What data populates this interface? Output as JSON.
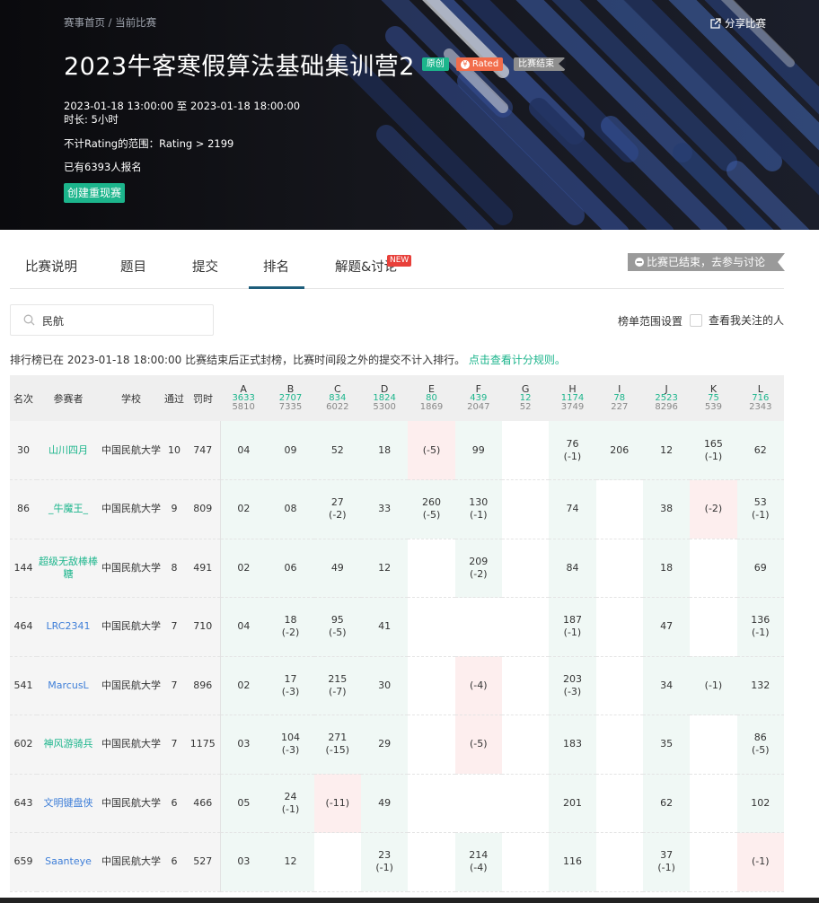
{
  "banner": {
    "breadcrumb": "赛事首页 / 当前比赛",
    "share_label": "分享比赛",
    "title": "2023牛客寒假算法基础集训营2",
    "tags": {
      "original": "原创",
      "rated": "Rated",
      "status": "比赛结束"
    },
    "time_range": "2023-01-18 13:00:00 至 2023-01-18 18:00:00",
    "duration": "时长: 5小时",
    "rating_range": "不计Rating的范围：Rating > 2199",
    "registered": "已有6393人报名",
    "replay_button": "创建重现赛"
  },
  "tabs": [
    {
      "label": "比赛说明"
    },
    {
      "label": "题目"
    },
    {
      "label": "提交"
    },
    {
      "label": "排名"
    },
    {
      "label": "解题&讨论"
    }
  ],
  "active_tab": "排名",
  "new_badge": "NEW",
  "discuss_button": "比赛已结束，去参与讨论",
  "search": {
    "value": "民航"
  },
  "range_setting": "榜单范围设置",
  "follow_label": "查看我关注的人",
  "notice": {
    "text": "排行榜已在 2023-01-18 18:00:00 比赛结束后正式封榜，比赛时间段之外的提交不计入排行。",
    "link": "点击查看计分规则。"
  },
  "colors": {
    "accent": "#1cb58c",
    "accepted_bg": "#f0f8f5",
    "failed_bg": "#fdeeee",
    "link_blue": "#3f7fd8"
  },
  "table": {
    "headers": {
      "rank": "名次",
      "team": "参赛者",
      "school": "学校",
      "solved": "通过",
      "penalty": "罚时"
    },
    "problems": [
      {
        "id": "A",
        "ac": "3633",
        "tried": "5810"
      },
      {
        "id": "B",
        "ac": "2707",
        "tried": "7335"
      },
      {
        "id": "C",
        "ac": "834",
        "tried": "6022"
      },
      {
        "id": "D",
        "ac": "1824",
        "tried": "5300"
      },
      {
        "id": "E",
        "ac": "80",
        "tried": "1869"
      },
      {
        "id": "F",
        "ac": "439",
        "tried": "2047"
      },
      {
        "id": "G",
        "ac": "12",
        "tried": "52"
      },
      {
        "id": "H",
        "ac": "1174",
        "tried": "3749"
      },
      {
        "id": "I",
        "ac": "78",
        "tried": "227"
      },
      {
        "id": "J",
        "ac": "2523",
        "tried": "8296"
      },
      {
        "id": "K",
        "ac": "75",
        "tried": "539"
      },
      {
        "id": "L",
        "ac": "716",
        "tried": "2343"
      }
    ],
    "rows": [
      {
        "rank": "30",
        "name": "山川四月",
        "name_color": "green",
        "school": "中国民航大学",
        "solved": "10",
        "penalty": "747",
        "cells": [
          {
            "s": "ok",
            "t": "04"
          },
          {
            "s": "ok",
            "t": "09"
          },
          {
            "s": "ok",
            "t": "52"
          },
          {
            "s": "ok",
            "t": "18"
          },
          {
            "s": "no",
            "t": "(-5)"
          },
          {
            "s": "ok",
            "t": "99"
          },
          {
            "s": "em",
            "t": ""
          },
          {
            "s": "ok",
            "t": "76",
            "w": "(-1)"
          },
          {
            "s": "ok",
            "t": "206"
          },
          {
            "s": "ok",
            "t": "12"
          },
          {
            "s": "ok",
            "t": "165",
            "w": "(-1)"
          },
          {
            "s": "ok",
            "t": "62"
          }
        ]
      },
      {
        "rank": "86",
        "name": "_牛魔王_",
        "name_color": "green",
        "school": "中国民航大学",
        "solved": "9",
        "penalty": "809",
        "cells": [
          {
            "s": "ok",
            "t": "02"
          },
          {
            "s": "ok",
            "t": "08"
          },
          {
            "s": "ok",
            "t": "27",
            "w": "(-2)"
          },
          {
            "s": "ok",
            "t": "33"
          },
          {
            "s": "ok",
            "t": "260",
            "w": "(-5)"
          },
          {
            "s": "ok",
            "t": "130",
            "w": "(-1)"
          },
          {
            "s": "em",
            "t": ""
          },
          {
            "s": "ok",
            "t": "74"
          },
          {
            "s": "em",
            "t": ""
          },
          {
            "s": "ok",
            "t": "38"
          },
          {
            "s": "no",
            "t": "(-2)"
          },
          {
            "s": "ok",
            "t": "53",
            "w": "(-1)"
          }
        ]
      },
      {
        "rank": "144",
        "name": "超级无敌棒棒糖",
        "name_color": "green",
        "school": "中国民航大学",
        "solved": "8",
        "penalty": "491",
        "cells": [
          {
            "s": "ok",
            "t": "02"
          },
          {
            "s": "ok",
            "t": "06"
          },
          {
            "s": "ok",
            "t": "49"
          },
          {
            "s": "ok",
            "t": "12"
          },
          {
            "s": "em",
            "t": ""
          },
          {
            "s": "ok",
            "t": "209",
            "w": "(-2)"
          },
          {
            "s": "em",
            "t": ""
          },
          {
            "s": "ok",
            "t": "84"
          },
          {
            "s": "em",
            "t": ""
          },
          {
            "s": "ok",
            "t": "18"
          },
          {
            "s": "em",
            "t": ""
          },
          {
            "s": "ok",
            "t": "69"
          }
        ]
      },
      {
        "rank": "464",
        "name": "LRC2341",
        "name_color": "blue",
        "school": "中国民航大学",
        "solved": "7",
        "penalty": "710",
        "cells": [
          {
            "s": "ok",
            "t": "04"
          },
          {
            "s": "ok",
            "t": "18",
            "w": "(-2)"
          },
          {
            "s": "ok",
            "t": "95",
            "w": "(-5)"
          },
          {
            "s": "ok",
            "t": "41"
          },
          {
            "s": "em",
            "t": ""
          },
          {
            "s": "em",
            "t": ""
          },
          {
            "s": "em",
            "t": ""
          },
          {
            "s": "ok",
            "t": "187",
            "w": "(-1)"
          },
          {
            "s": "em",
            "t": ""
          },
          {
            "s": "ok",
            "t": "47"
          },
          {
            "s": "em",
            "t": ""
          },
          {
            "s": "ok",
            "t": "136",
            "w": "(-1)"
          }
        ]
      },
      {
        "rank": "541",
        "name": "MarcusL",
        "name_color": "blue",
        "school": "中国民航大学",
        "solved": "7",
        "penalty": "896",
        "cells": [
          {
            "s": "ok",
            "t": "02"
          },
          {
            "s": "ok",
            "t": "17",
            "w": "(-3)"
          },
          {
            "s": "ok",
            "t": "215",
            "w": "(-7)"
          },
          {
            "s": "ok",
            "t": "30"
          },
          {
            "s": "em",
            "t": ""
          },
          {
            "s": "no",
            "t": "(-4)"
          },
          {
            "s": "em",
            "t": ""
          },
          {
            "s": "ok",
            "t": "203",
            "w": "(-3)"
          },
          {
            "s": "em",
            "t": ""
          },
          {
            "s": "ok",
            "t": "34"
          },
          {
            "s": "ok",
            "t": "(-1)"
          },
          {
            "s": "ok",
            "t": "132"
          }
        ]
      },
      {
        "rank": "602",
        "name": "神风游骑兵",
        "name_color": "green",
        "school": "中国民航大学",
        "solved": "7",
        "penalty": "1175",
        "cells": [
          {
            "s": "ok",
            "t": "03"
          },
          {
            "s": "ok",
            "t": "104",
            "w": "(-3)"
          },
          {
            "s": "ok",
            "t": "271",
            "w": "(-15)"
          },
          {
            "s": "ok",
            "t": "29"
          },
          {
            "s": "em",
            "t": ""
          },
          {
            "s": "no",
            "t": "(-5)"
          },
          {
            "s": "em",
            "t": ""
          },
          {
            "s": "ok",
            "t": "183"
          },
          {
            "s": "em",
            "t": ""
          },
          {
            "s": "ok",
            "t": "35"
          },
          {
            "s": "em",
            "t": ""
          },
          {
            "s": "ok",
            "t": "86",
            "w": "(-5)"
          }
        ]
      },
      {
        "rank": "643",
        "name": "文明键盘侠",
        "name_color": "blue",
        "school": "中国民航大学",
        "solved": "6",
        "penalty": "466",
        "cells": [
          {
            "s": "ok",
            "t": "05"
          },
          {
            "s": "ok",
            "t": "24",
            "w": "(-1)"
          },
          {
            "s": "no",
            "t": "(-11)"
          },
          {
            "s": "ok",
            "t": "49"
          },
          {
            "s": "em",
            "t": ""
          },
          {
            "s": "em",
            "t": ""
          },
          {
            "s": "em",
            "t": ""
          },
          {
            "s": "ok",
            "t": "201"
          },
          {
            "s": "em",
            "t": ""
          },
          {
            "s": "ok",
            "t": "62"
          },
          {
            "s": "em",
            "t": ""
          },
          {
            "s": "ok",
            "t": "102"
          }
        ]
      },
      {
        "rank": "659",
        "name": "Saanteye",
        "name_color": "blue",
        "school": "中国民航大学",
        "solved": "6",
        "penalty": "527",
        "cells": [
          {
            "s": "ok",
            "t": "03"
          },
          {
            "s": "ok",
            "t": "12"
          },
          {
            "s": "em",
            "t": ""
          },
          {
            "s": "ok",
            "t": "23",
            "w": "(-1)"
          },
          {
            "s": "em",
            "t": ""
          },
          {
            "s": "ok",
            "t": "214",
            "w": "(-4)"
          },
          {
            "s": "em",
            "t": ""
          },
          {
            "s": "ok",
            "t": "116"
          },
          {
            "s": "em",
            "t": ""
          },
          {
            "s": "ok",
            "t": "37",
            "w": "(-1)"
          },
          {
            "s": "em",
            "t": ""
          },
          {
            "s": "no",
            "t": "(-1)"
          }
        ]
      }
    ]
  }
}
